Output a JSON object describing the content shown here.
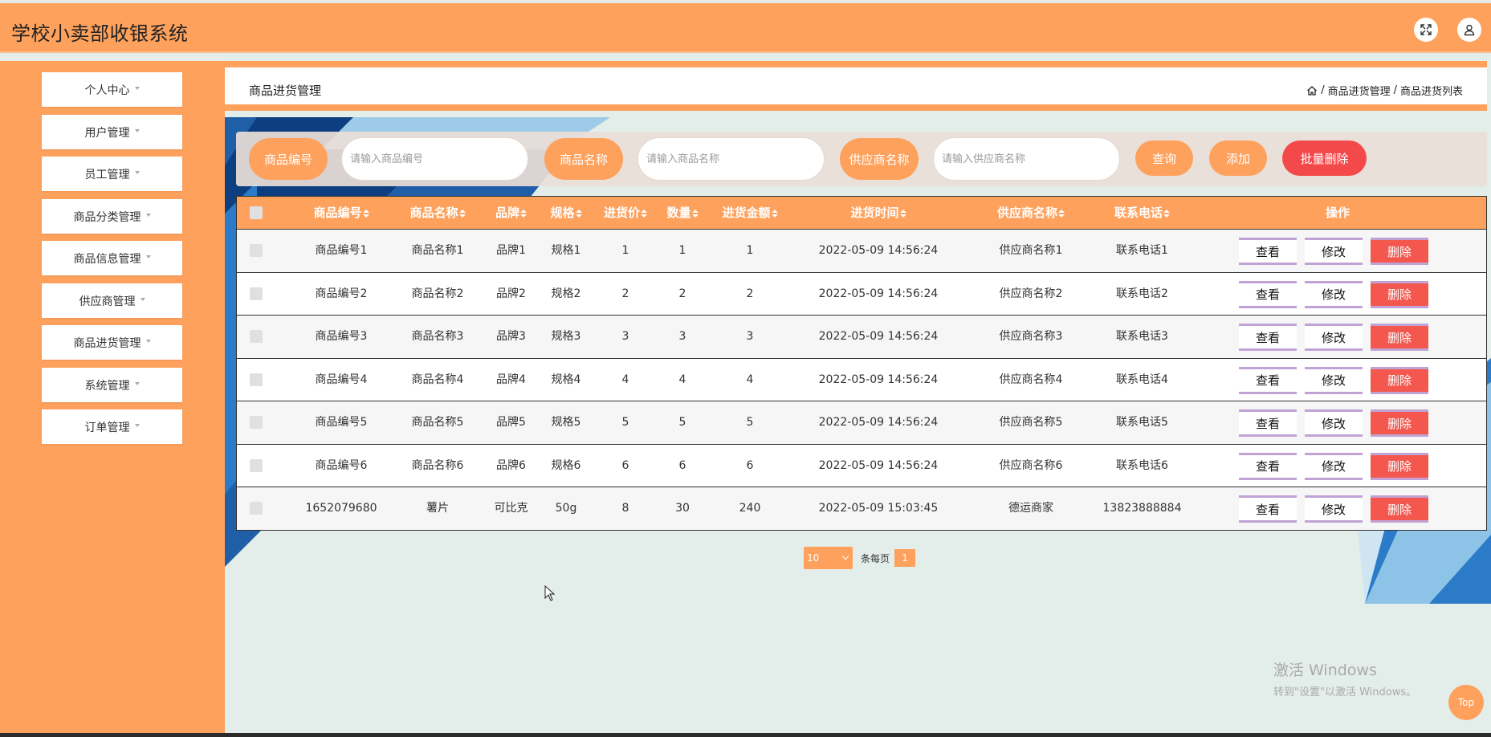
{
  "app": {
    "title": "学校小卖部收银系统"
  },
  "header": {
    "fullscreen_icon": "expand-icon",
    "user_icon": "user-icon"
  },
  "sidebar": {
    "items": [
      {
        "label": "个人中心"
      },
      {
        "label": "用户管理"
      },
      {
        "label": "员工管理"
      },
      {
        "label": "商品分类管理"
      },
      {
        "label": "商品信息管理"
      },
      {
        "label": "供应商管理"
      },
      {
        "label": "商品进货管理"
      },
      {
        "label": "系统管理"
      },
      {
        "label": "订单管理"
      }
    ]
  },
  "breadcrumb": {
    "title": "商品进货管理",
    "path": [
      "商品进货管理",
      "商品进货列表"
    ],
    "separator": "/"
  },
  "search": {
    "code_label": "商品编号",
    "code_placeholder": "请输入商品编号",
    "name_label": "商品名称",
    "name_placeholder": "请输入商品名称",
    "supplier_label": "供应商名称",
    "supplier_placeholder": "请输入供应商名称",
    "query_label": "查询",
    "add_label": "添加",
    "batch_delete_label": "批量删除"
  },
  "table": {
    "columns": [
      "商品编号",
      "商品名称",
      "品牌",
      "规格",
      "进货价",
      "数量",
      "进货金额",
      "进货时间",
      "供应商名称",
      "联系电话",
      "操作"
    ],
    "view_label": "查看",
    "edit_label": "修改",
    "delete_label": "删除",
    "rows": [
      [
        "商品编号1",
        "商品名称1",
        "品牌1",
        "规格1",
        "1",
        "1",
        "1",
        "2022-05-09 14:56:24",
        "供应商名称1",
        "联系电话1"
      ],
      [
        "商品编号2",
        "商品名称2",
        "品牌2",
        "规格2",
        "2",
        "2",
        "2",
        "2022-05-09 14:56:24",
        "供应商名称2",
        "联系电话2"
      ],
      [
        "商品编号3",
        "商品名称3",
        "品牌3",
        "规格3",
        "3",
        "3",
        "3",
        "2022-05-09 14:56:24",
        "供应商名称3",
        "联系电话3"
      ],
      [
        "商品编号4",
        "商品名称4",
        "品牌4",
        "规格4",
        "4",
        "4",
        "4",
        "2022-05-09 14:56:24",
        "供应商名称4",
        "联系电话4"
      ],
      [
        "商品编号5",
        "商品名称5",
        "品牌5",
        "规格5",
        "5",
        "5",
        "5",
        "2022-05-09 14:56:24",
        "供应商名称5",
        "联系电话5"
      ],
      [
        "商品编号6",
        "商品名称6",
        "品牌6",
        "规格6",
        "6",
        "6",
        "6",
        "2022-05-09 14:56:24",
        "供应商名称6",
        "联系电话6"
      ],
      [
        "1652079680",
        "薯片",
        "可比克",
        "50g",
        "8",
        "30",
        "240",
        "2022-05-09 15:03:45",
        "德运商家",
        "13823888884"
      ]
    ]
  },
  "pagination": {
    "page_size": "10",
    "per_page_label": "条每页",
    "current_page": "1"
  },
  "watermark": {
    "line1": "激活 Windows",
    "line2": "转到\"设置\"以激活 Windows。"
  },
  "top_button": {
    "label": "Top"
  },
  "colors": {
    "accent": "#fea15c",
    "danger": "#f4494b",
    "background": "#e3ede9"
  }
}
